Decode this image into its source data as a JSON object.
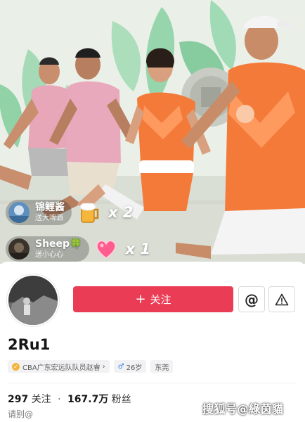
{
  "gifts": [
    {
      "user": "锦鲤酱",
      "message": "送大啤酒",
      "gift_icon": "beer-mug-icon",
      "count": "x 2"
    },
    {
      "user": "Sheep🍀",
      "message": "送小心心",
      "gift_icon": "heart-icon",
      "count": "x 1"
    }
  ],
  "profile": {
    "follow_label": "关注",
    "at_label": "@",
    "username": "2Ru1",
    "tags": {
      "verified": "CBA广东宏远队队员赵睿",
      "age": "26岁",
      "location": "东莞"
    },
    "stats": {
      "following_count": "297",
      "following_label": "关注",
      "separator": "·",
      "followers_count": "167.7万",
      "followers_label": "粉丝"
    },
    "bio": "请别@"
  },
  "watermark": "搜狐号@綠茵貓",
  "colors": {
    "follow_button": "#ea3c55",
    "jersey_orange": "#f47a3a",
    "shirt_pink": "#e9a9bc"
  }
}
